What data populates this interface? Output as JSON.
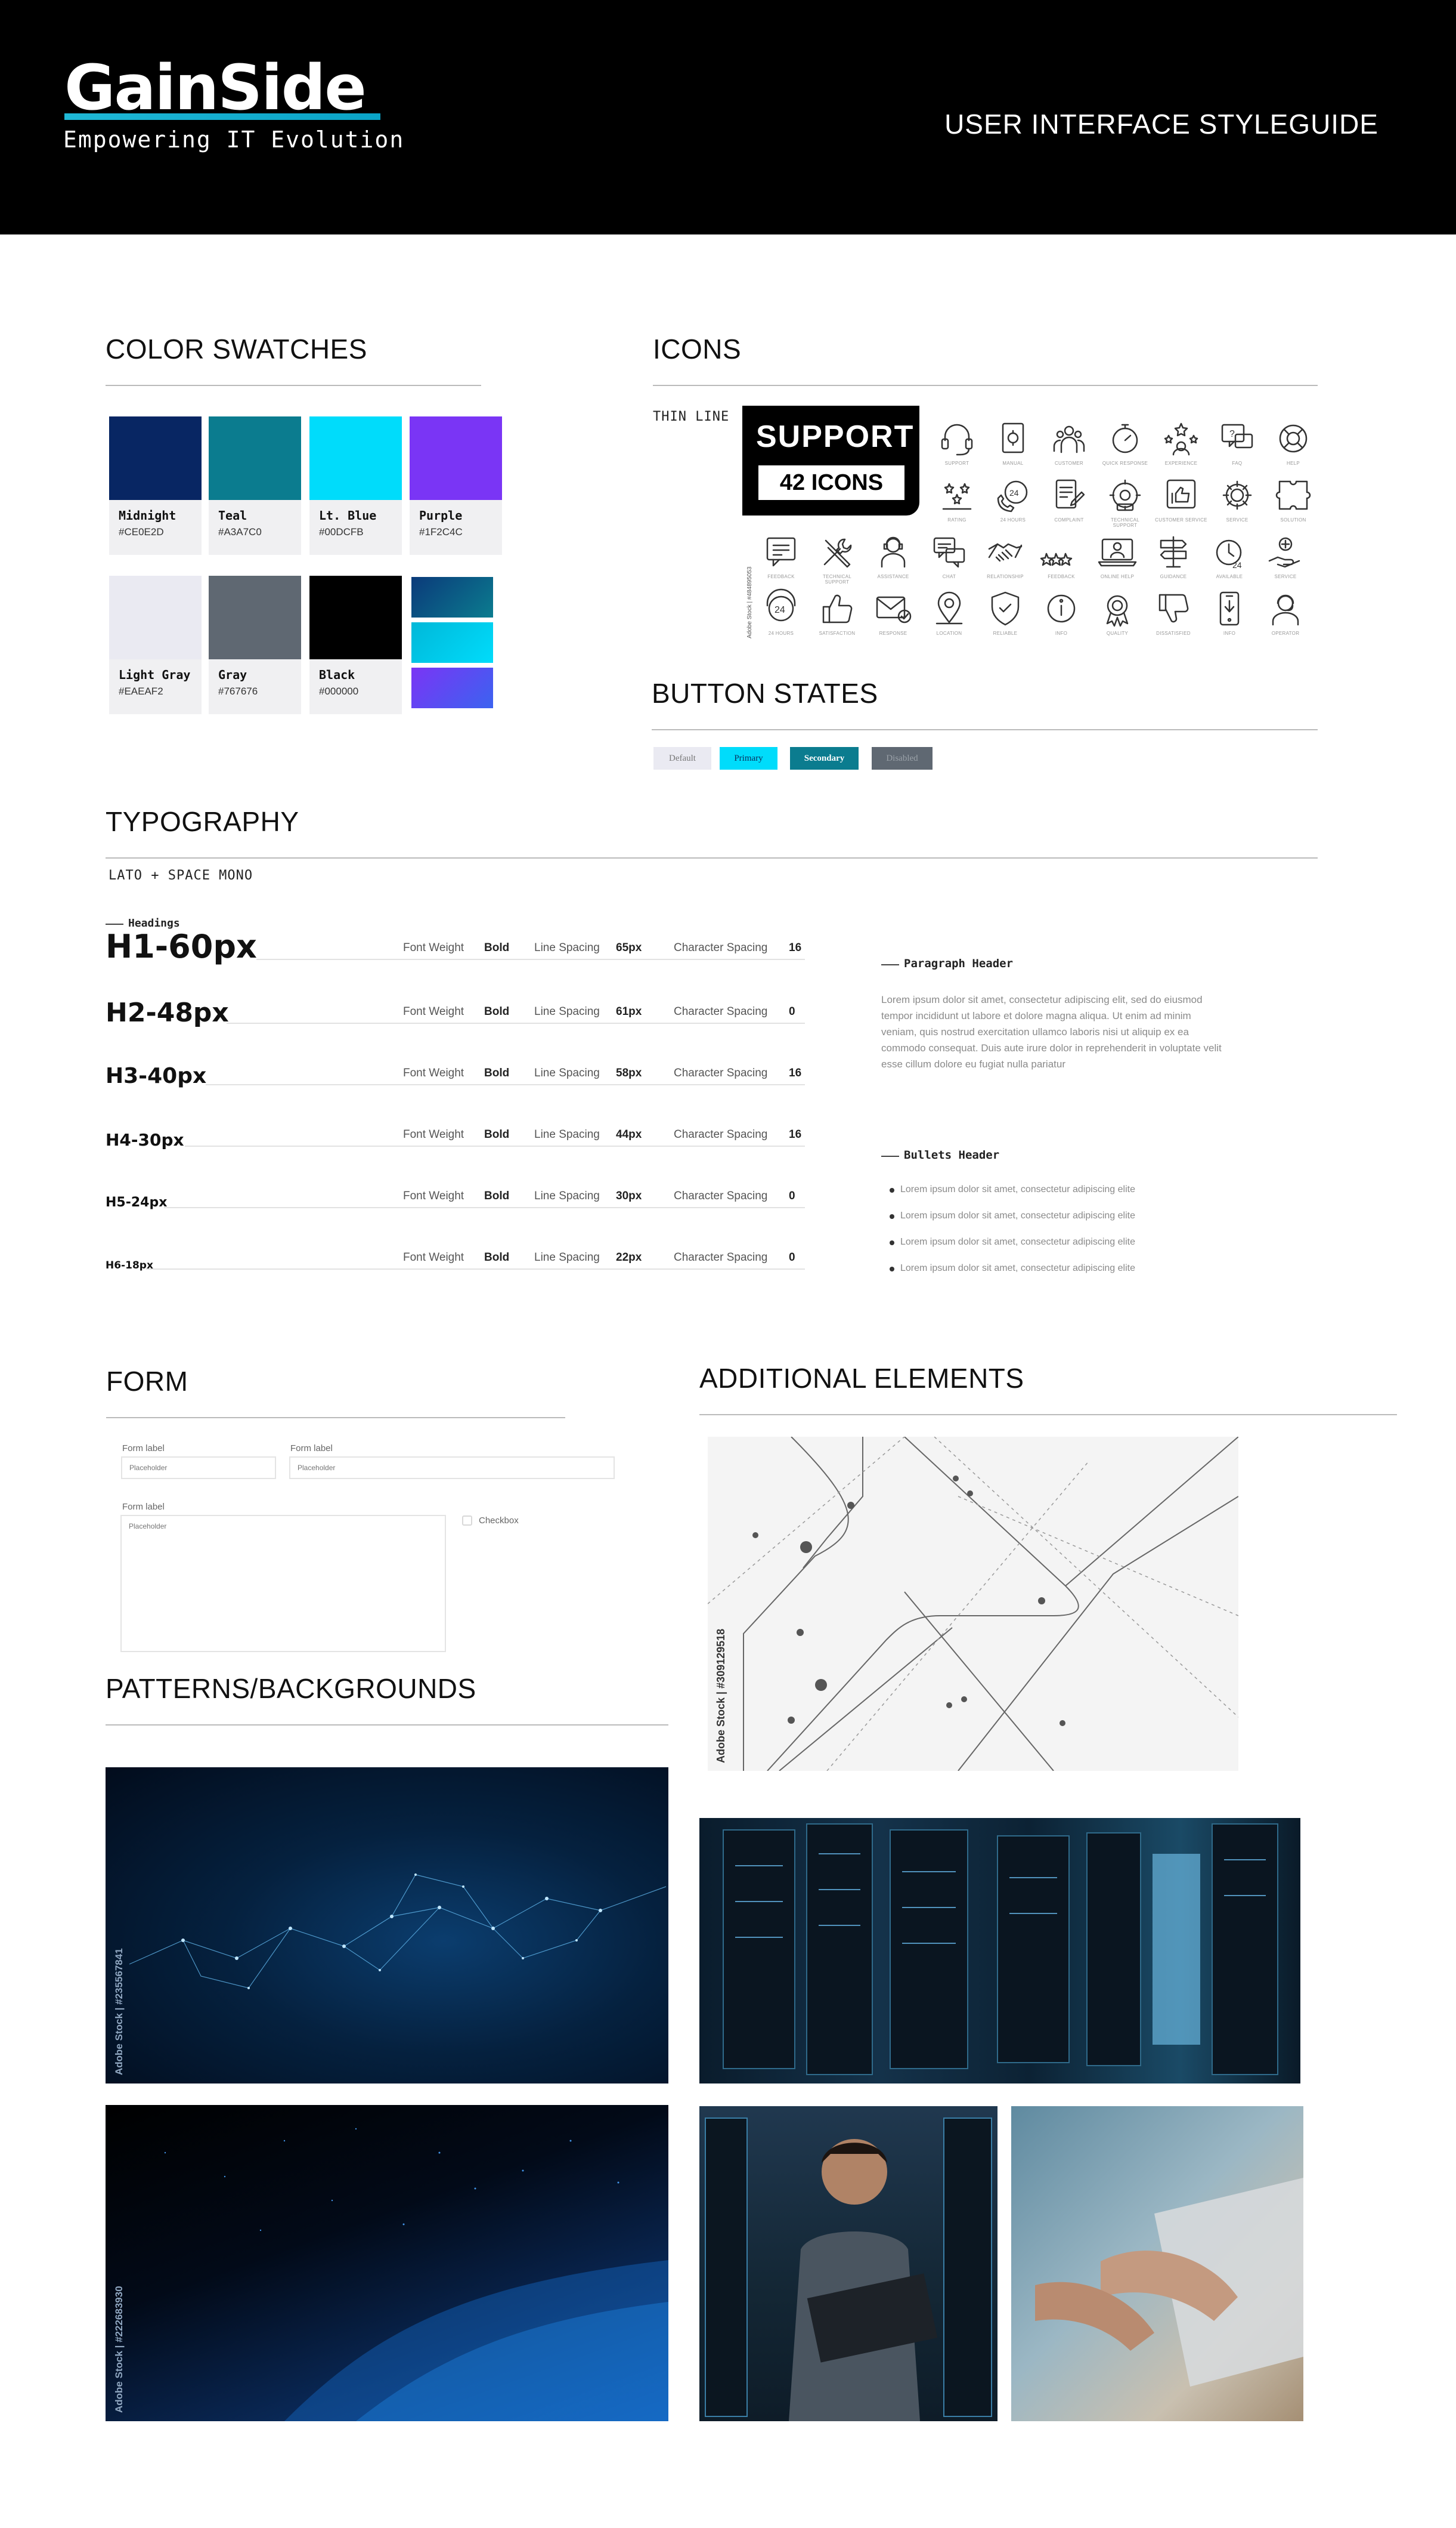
{
  "header": {
    "brand": "GainSide",
    "tagline": "Empowering IT Evolution",
    "title": "USER INTERFACE STYLEGUIDE"
  },
  "swatches": {
    "title": "COLOR SWATCHES",
    "items": [
      {
        "name": "Midnight",
        "hex": "#CE0E2D",
        "color": "#082663"
      },
      {
        "name": "Teal",
        "hex": "#A3A7C0",
        "color": "#0b7c8f"
      },
      {
        "name": "Lt. Blue",
        "hex": "#00DCFB",
        "color": "#00dcfb"
      },
      {
        "name": "Purple",
        "hex": "#1F2C4C",
        "color": "#7a35f5"
      },
      {
        "name": "Light Gray",
        "hex": "#EAEAF2",
        "color": "#eaeaf2"
      },
      {
        "name": "Gray",
        "hex": "#767676",
        "color": "#5f6872"
      },
      {
        "name": "Black",
        "hex": "#000000",
        "color": "#000000"
      }
    ],
    "gradients": [
      "#0b3a7a→#0b7c8f",
      "#00b8d9→#00dcfb",
      "#7a35f5→#3b63f0"
    ]
  },
  "icons": {
    "title": "ICONS",
    "style_label": "THIN LINE",
    "badge_title": "SUPPORT",
    "badge_count": "42 ICONS",
    "stock_id": "Adobe Stock | #484895053",
    "rows": [
      [
        {
          "icon": "headset-icon",
          "label": "SUPPORT"
        },
        {
          "icon": "manual-icon",
          "label": "MANUAL"
        },
        {
          "icon": "customers-icon",
          "label": "CUSTOMER"
        },
        {
          "icon": "stopwatch-icon",
          "label": "QUICK RESPONSE"
        },
        {
          "icon": "experience-icon",
          "label": "EXPERIENCE"
        },
        {
          "icon": "faq-icon",
          "label": "FAQ"
        },
        {
          "icon": "lifebuoy-icon",
          "label": "HELP"
        }
      ],
      [
        {
          "icon": "rating-icon",
          "label": "RATING"
        },
        {
          "icon": "24h-call-icon",
          "label": "24 HOURS"
        },
        {
          "icon": "complaint-icon",
          "label": "COMPLAINT"
        },
        {
          "icon": "technical-support-icon",
          "label": "TECHNICAL SUPPORT"
        },
        {
          "icon": "customer-service-icon",
          "label": "CUSTOMER SERVICE"
        },
        {
          "icon": "gear-icon",
          "label": "SERVICE"
        },
        {
          "icon": "puzzle-icon",
          "label": "SOLUTION"
        }
      ],
      [
        {
          "icon": "feedback-icon",
          "label": "FEEDBACK"
        },
        {
          "icon": "tools-icon",
          "label": "TECHNICAL SUPPORT"
        },
        {
          "icon": "agent-icon",
          "label": "ASSISTANCE"
        },
        {
          "icon": "chat-icon",
          "label": "CHAT"
        },
        {
          "icon": "handshake-icon",
          "label": "RELATIONSHIP"
        },
        {
          "icon": "stars-icon",
          "label": "FEEDBACK"
        },
        {
          "icon": "online-help-icon",
          "label": "ONLINE HELP"
        },
        {
          "icon": "signpost-icon",
          "label": "GUIDANCE"
        },
        {
          "icon": "available-icon",
          "label": "AVAILABLE"
        },
        {
          "icon": "care-icon",
          "label": "SERVICE"
        }
      ],
      [
        {
          "icon": "24h-support-icon",
          "label": "24 HOURS"
        },
        {
          "icon": "thumbs-up-icon",
          "label": "SATISFACTION"
        },
        {
          "icon": "mail-response-icon",
          "label": "RESPONSE"
        },
        {
          "icon": "location-icon",
          "label": "LOCATION"
        },
        {
          "icon": "shield-icon",
          "label": "RELIABLE"
        },
        {
          "icon": "info-icon",
          "label": "INFO"
        },
        {
          "icon": "quality-icon",
          "label": "QUALITY"
        },
        {
          "icon": "thumbs-down-icon",
          "label": "DISSATISFIED"
        },
        {
          "icon": "mobile-icon",
          "label": "INFO"
        },
        {
          "icon": "operator-icon",
          "label": "OPERATOR"
        }
      ]
    ]
  },
  "buttons": {
    "title": "BUTTON STATES",
    "items": [
      {
        "label": "Default",
        "bg": "#eaeaf2",
        "fg": "#777777"
      },
      {
        "label": "Primary",
        "bg": "#00dcfb",
        "fg": "#0b2f5c"
      },
      {
        "label": "Secondary",
        "bg": "#0b7c8f",
        "fg": "#ffffff"
      },
      {
        "label": "Disabled",
        "bg": "#5f6872",
        "fg": "#9aa1a8"
      }
    ]
  },
  "typography": {
    "title": "TYPOGRAPHY",
    "fonts": "LATO + SPACE MONO",
    "headings_label": "Headings",
    "fw_label": "Font Weight",
    "ls_label": "Line Spacing",
    "cs_label": "Character Spacing",
    "rows": [
      {
        "label": "H1-60px",
        "weight": "Bold",
        "line": "65px",
        "char": "16"
      },
      {
        "label": "H2-48px",
        "weight": "Bold",
        "line": "61px",
        "char": "0"
      },
      {
        "label": "H3-40px",
        "weight": "Bold",
        "line": "58px",
        "char": "16"
      },
      {
        "label": "H4-30px",
        "weight": "Bold",
        "line": "44px",
        "char": "16"
      },
      {
        "label": "H5-24px",
        "weight": "Bold",
        "line": "30px",
        "char": "0"
      },
      {
        "label": "H6-18px",
        "weight": "Bold",
        "line": "22px",
        "char": "0"
      }
    ],
    "paragraph_header": "Paragraph Header",
    "paragraph": "Lorem ipsum dolor sit amet, consectetur adipiscing elit, sed do eiusmod tempor incididunt ut labore et dolore magna aliqua. Ut enim ad minim veniam, quis nostrud exercitation ullamco laboris nisi ut aliquip ex ea commodo consequat. Duis aute irure dolor in reprehenderit in voluptate velit esse cillum dolore eu fugiat nulla pariatur",
    "bullets_header": "Bullets Header",
    "bullets": [
      "Lorem ipsum dolor sit amet, consectetur adipiscing elite",
      "Lorem ipsum dolor sit amet, consectetur adipiscing elite",
      "Lorem ipsum dolor sit amet, consectetur adipiscing elite",
      "Lorem ipsum dolor sit amet, consectetur adipiscing elite"
    ]
  },
  "form": {
    "title": "FORM",
    "label1": "Form label",
    "label2": "Form label",
    "label3": "Form label",
    "placeholder": "Placeholder",
    "checkbox_label": "Checkbox"
  },
  "additional": {
    "title": "ADDITIONAL ELEMENTS",
    "stock_id": "Adobe Stock | #309129518"
  },
  "patterns": {
    "title": "PATTERNS/BACKGROUNDS",
    "stock_1": "Adobe Stock | #235567841",
    "stock_2": "Adobe Stock | #222683930"
  }
}
